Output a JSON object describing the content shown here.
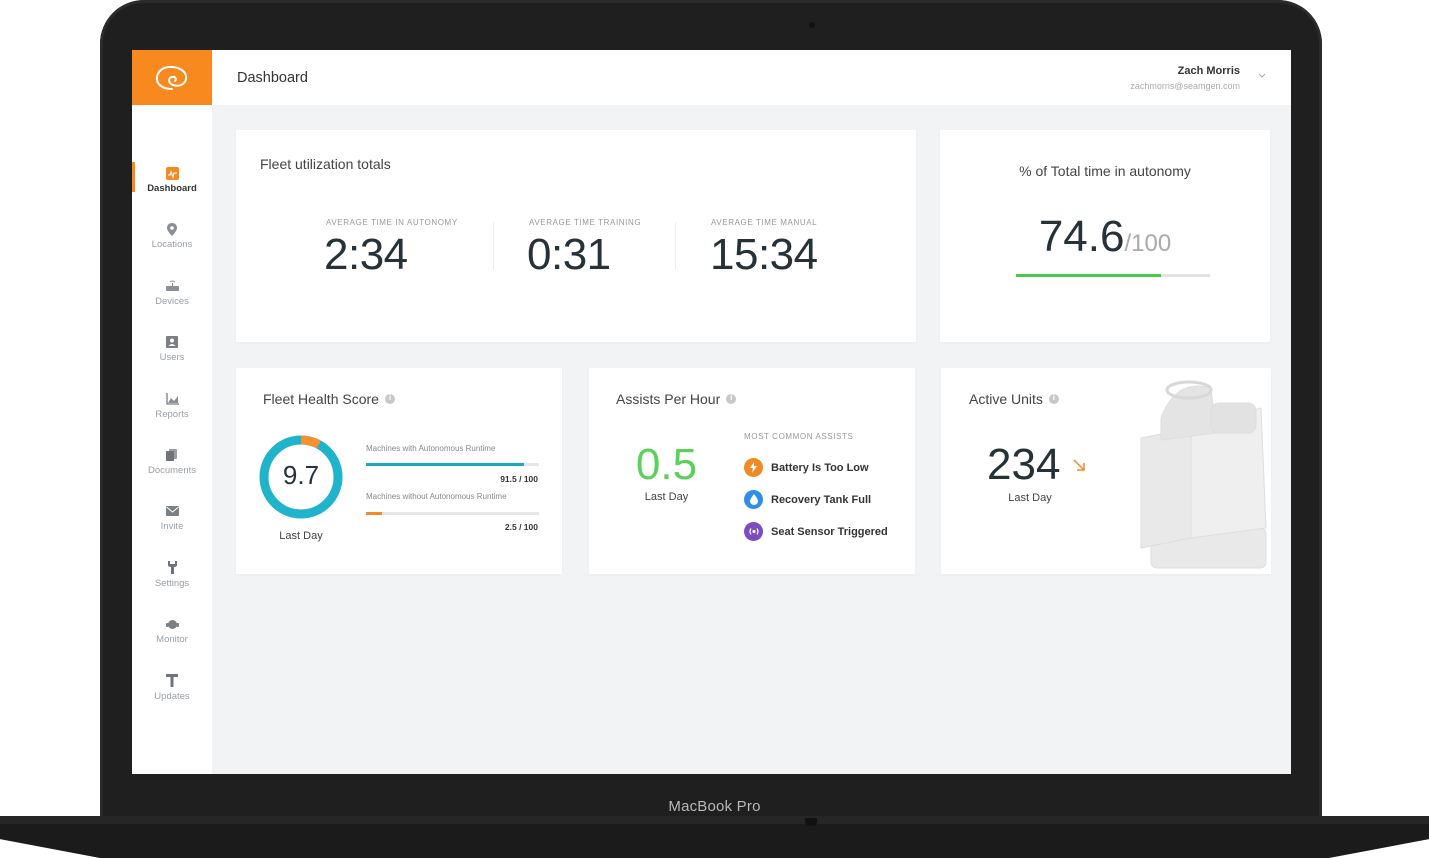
{
  "device": {
    "brand_label": "MacBook Pro"
  },
  "app": {
    "logo_icon": "swirl-logo-icon",
    "accent_color": "#f7891f",
    "page_title": "Dashboard",
    "user": {
      "name": "Zach Morris",
      "email": "zachmorris@seamgen.com",
      "menu_icon": "chevron-down-icon"
    }
  },
  "sidebar": {
    "items": [
      {
        "label": "Dashboard",
        "icon": "dashboard-icon",
        "active": true
      },
      {
        "label": "Locations",
        "icon": "map-pin-icon",
        "active": false
      },
      {
        "label": "Devices",
        "icon": "router-icon",
        "active": false
      },
      {
        "label": "Users",
        "icon": "user-badge-icon",
        "active": false
      },
      {
        "label": "Reports",
        "icon": "chart-icon",
        "active": false
      },
      {
        "label": "Documents",
        "icon": "documents-icon",
        "active": false
      },
      {
        "label": "Invite",
        "icon": "envelope-icon",
        "active": false
      },
      {
        "label": "Settings",
        "icon": "wrench-icon",
        "active": false
      },
      {
        "label": "Monitor",
        "icon": "headset-icon",
        "active": false
      },
      {
        "label": "Updates",
        "icon": "antenna-icon",
        "active": false
      }
    ]
  },
  "fleet_utilization": {
    "title": "Fleet utilization totals",
    "stats": [
      {
        "label": "AVERAGE TIME IN AUTONOMY",
        "value": "2:34"
      },
      {
        "label": "AVERAGE TIME TRAINING",
        "value": "0:31"
      },
      {
        "label": "AVERAGE TIME MANUAL",
        "value": "15:34"
      }
    ]
  },
  "autonomy_pct": {
    "title": "% of Total time in autonomy",
    "value": "74.6",
    "denominator": "/100",
    "progress_fraction": 0.746,
    "bar_color": "#4cc94c"
  },
  "fleet_health": {
    "title": "Fleet Health Score",
    "score": "9.7",
    "period": "Last Day",
    "ring": {
      "main_color": "#1fb3cc",
      "secondary_color": "#f39233",
      "secondary_fraction": 0.08
    },
    "bars": [
      {
        "label": "Machines with Autonomous Runtime",
        "value_text": "91.5 / 100",
        "fraction": 0.915,
        "color": "#1ea8c0"
      },
      {
        "label": "Machines without Autonomous Runtime",
        "value_text": "2.5 / 100",
        "fraction": 0.09,
        "color": "#f08a2e"
      }
    ]
  },
  "assists": {
    "title": "Assists Per Hour",
    "value": "0.5",
    "period": "Last Day",
    "list_title": "MOST COMMON ASSISTS",
    "items": [
      {
        "label": "Battery Is Too Low",
        "icon": "lightning-icon",
        "color": "#f08a24"
      },
      {
        "label": "Recovery Tank Full",
        "icon": "water-drop-icon",
        "color": "#2f8fe6"
      },
      {
        "label": "Seat Sensor Triggered",
        "icon": "sensor-icon",
        "color": "#7c4bc2"
      }
    ]
  },
  "active_units": {
    "title": "Active Units",
    "value": "234",
    "trend": "down",
    "trend_icon": "arrow-down-right-icon",
    "trend_color": "#f08a24",
    "period": "Last Day",
    "image": "floor-scrubber-robot-image"
  }
}
